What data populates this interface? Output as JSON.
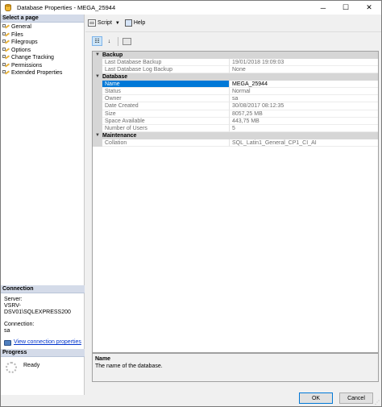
{
  "window": {
    "title": "Database Properties - MEGA_25944",
    "controls": {
      "minimize": "─",
      "maximize": "☐",
      "close": "✕"
    }
  },
  "left_pane": {
    "select_page_header": "Select a page",
    "pages": [
      {
        "label": "General",
        "icon": "wrench-page-icon"
      },
      {
        "label": "Files",
        "icon": "wrench-page-icon"
      },
      {
        "label": "Filegroups",
        "icon": "wrench-page-icon"
      },
      {
        "label": "Options",
        "icon": "wrench-page-icon"
      },
      {
        "label": "Change Tracking",
        "icon": "wrench-page-icon"
      },
      {
        "label": "Permissions",
        "icon": "wrench-page-icon"
      },
      {
        "label": "Extended Properties",
        "icon": "wrench-page-icon"
      }
    ],
    "connection": {
      "header": "Connection",
      "server_label": "Server:",
      "server_value": "VSRV-DSV01\\SQLEXPRESS200",
      "connection_label": "Connection:",
      "connection_value": "sa",
      "view_link": "View connection properties"
    },
    "progress": {
      "header": "Progress",
      "status": "Ready"
    }
  },
  "toolbar": {
    "script_label": "Script",
    "help_label": "Help"
  },
  "property_grid": {
    "categories": [
      {
        "name": "Backup",
        "properties": [
          {
            "name": "Last Database Backup",
            "value": "19/01/2018 19:09:03"
          },
          {
            "name": "Last Database Log Backup",
            "value": "None"
          }
        ]
      },
      {
        "name": "Database",
        "properties": [
          {
            "name": "Name",
            "value": "MEGA_25944"
          },
          {
            "name": "Status",
            "value": "Normal"
          },
          {
            "name": "Owner",
            "value": "sa"
          },
          {
            "name": "Date Created",
            "value": "30/08/2017 08:12:35"
          },
          {
            "name": "Size",
            "value": "8057,25 MB"
          },
          {
            "name": "Space Available",
            "value": "443,75 MB"
          },
          {
            "name": "Number of Users",
            "value": "5"
          }
        ]
      },
      {
        "name": "Maintenance",
        "properties": [
          {
            "name": "Collation",
            "value": "SQL_Latin1_General_CP1_CI_AI"
          }
        ]
      }
    ],
    "selected_property": "Name"
  },
  "description": {
    "title": "Name",
    "text": "The name of the database."
  },
  "buttons": {
    "ok": "OK",
    "cancel": "Cancel"
  }
}
